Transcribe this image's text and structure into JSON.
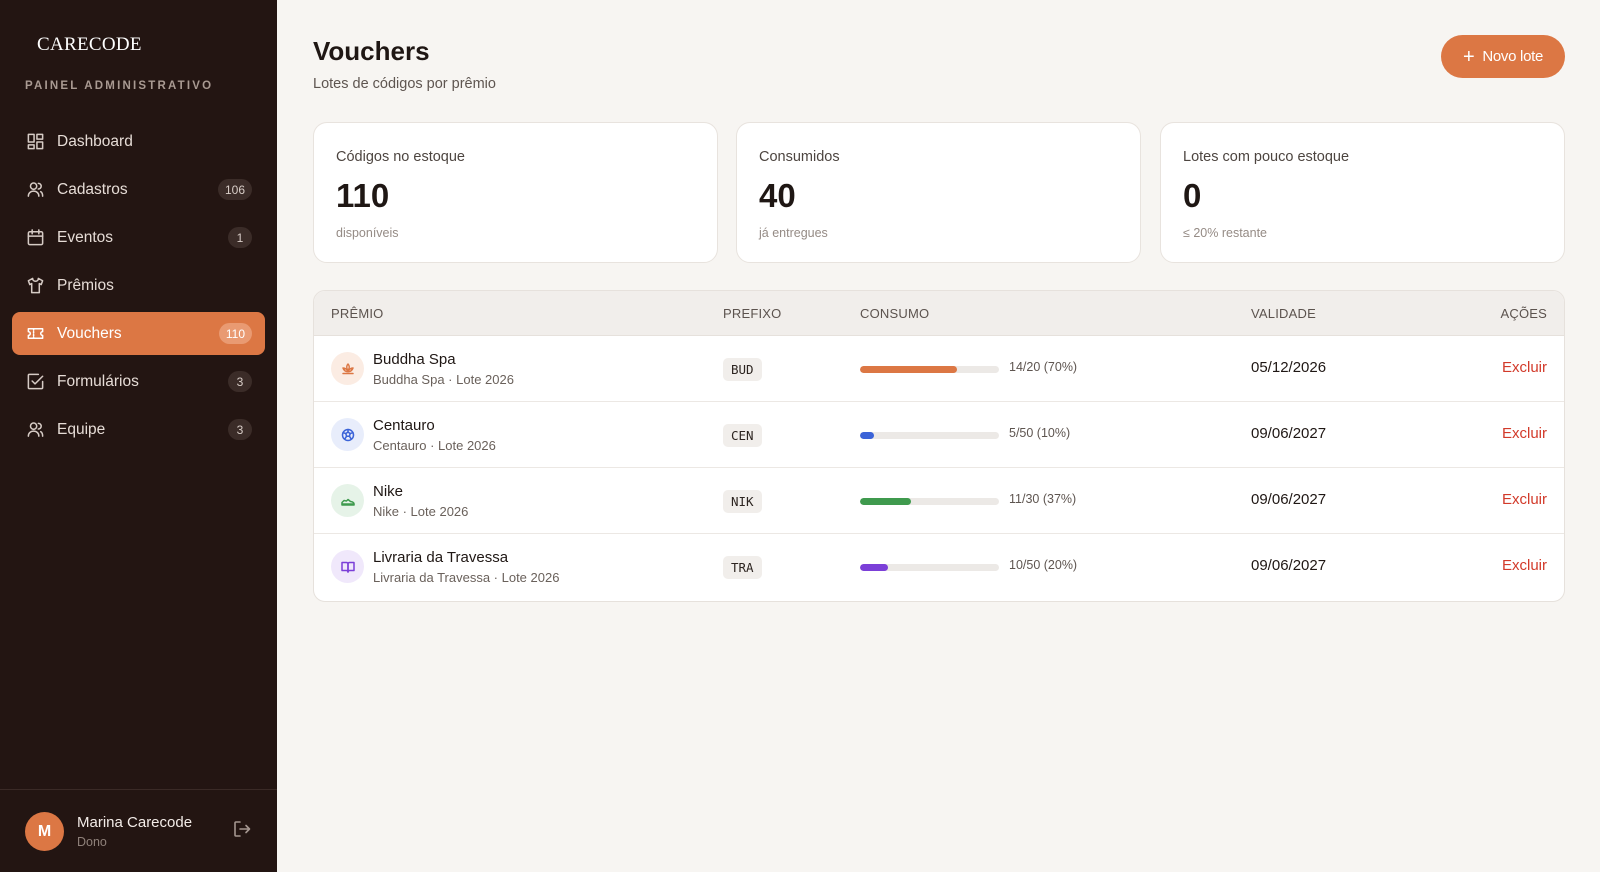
{
  "brand": {
    "name": "CARECODE",
    "subtitle": "PAINEL ADMINISTRATIVO"
  },
  "sidebar": {
    "items": [
      {
        "label": "Dashboard",
        "icon": "dashboard-icon",
        "badge": null
      },
      {
        "label": "Cadastros",
        "icon": "users-icon",
        "badge": "106"
      },
      {
        "label": "Eventos",
        "icon": "calendar-icon",
        "badge": "1"
      },
      {
        "label": "Prêmios",
        "icon": "shirt-icon",
        "badge": null
      },
      {
        "label": "Vouchers",
        "icon": "ticket-icon",
        "badge": "110",
        "active": true
      },
      {
        "label": "Formulários",
        "icon": "checkbox-icon",
        "badge": "3"
      },
      {
        "label": "Equipe",
        "icon": "team-icon",
        "badge": "3"
      }
    ]
  },
  "user": {
    "initial": "M",
    "name": "Marina Carecode",
    "role": "Dono",
    "logout_icon": "logout-icon"
  },
  "header": {
    "title": "Vouchers",
    "subtitle": "Lotes de códigos por prêmio",
    "new_button": "Novo lote"
  },
  "stats": [
    {
      "label": "Códigos no estoque",
      "value": "110",
      "hint": "disponíveis"
    },
    {
      "label": "Consumidos",
      "value": "40",
      "hint": "já entregues"
    },
    {
      "label": "Lotes com pouco estoque",
      "value": "0",
      "hint": "≤ 20% restante"
    }
  ],
  "table": {
    "headers": {
      "prize": "PRÊMIO",
      "prefix": "PREFIXO",
      "consumption": "CONSUMO",
      "validity": "VALIDADE",
      "actions": "AÇÕES"
    },
    "rows": [
      {
        "name": "Buddha Spa",
        "sub": "Buddha Spa · Lote 2026",
        "prefix": "BUD",
        "consumed": 14,
        "total": 20,
        "consumption": "14/20 (70%)",
        "validity": "05/12/2026",
        "action": "Excluir",
        "color": "#dc7744",
        "icon_bg": "#fbece3",
        "icon": "lotus-icon"
      },
      {
        "name": "Centauro",
        "sub": "Centauro · Lote 2026",
        "prefix": "CEN",
        "consumed": 5,
        "total": 50,
        "consumption": "5/50 (10%)",
        "validity": "09/06/2027",
        "action": "Excluir",
        "color": "#3b63d8",
        "icon_bg": "#e8edfb",
        "icon": "ball-icon"
      },
      {
        "name": "Nike",
        "sub": "Nike · Lote 2026",
        "prefix": "NIK",
        "consumed": 11,
        "total": 30,
        "consumption": "11/30 (37%)",
        "validity": "09/06/2027",
        "action": "Excluir",
        "color": "#3f9a4e",
        "icon_bg": "#e6f3e8",
        "icon": "shoe-icon"
      },
      {
        "name": "Livraria da Travessa",
        "sub": "Livraria da Travessa · Lote 2026",
        "prefix": "TRA",
        "consumed": 10,
        "total": 50,
        "consumption": "10/50 (20%)",
        "validity": "09/06/2027",
        "action": "Excluir",
        "color": "#7b3fd8",
        "icon_bg": "#f0e8fb",
        "icon": "book-icon"
      }
    ]
  }
}
